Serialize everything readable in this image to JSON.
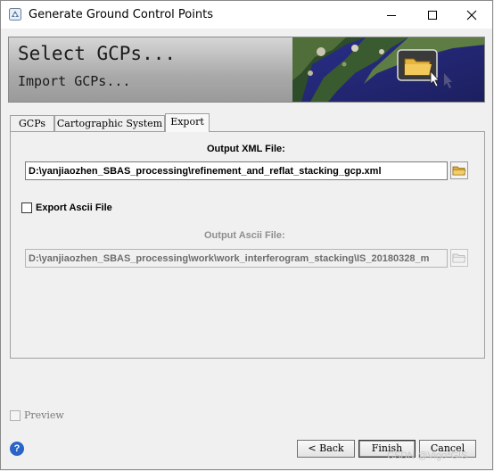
{
  "window": {
    "title": "Generate Ground Control Points",
    "controls": [
      "minimize-icon",
      "maximize-icon",
      "close-icon"
    ]
  },
  "banner": {
    "title": "Select GCPs...",
    "subtitle": "Import GCPs..."
  },
  "tabs": [
    {
      "label": "GCPs",
      "active": false
    },
    {
      "label": "Cartographic System",
      "active": false
    },
    {
      "label": "Export",
      "active": true
    }
  ],
  "export": {
    "output_xml_label": "Output XML File:",
    "output_xml_value": "D:\\yanjiaozhen_SBAS_processing\\refinement_and_reflat_stacking_gcp.xml",
    "export_ascii_label": "Export Ascii File",
    "export_ascii_checked": false,
    "output_ascii_label": "Output Ascii File:",
    "output_ascii_value": "D:\\yanjiaozhen_SBAS_processing\\work\\work_interferogram_stacking\\IS_20180328_m"
  },
  "footer": {
    "preview_label": "Preview",
    "preview_checked": false,
    "help_label": "?",
    "back_label": "< Back",
    "finish_label": "Finish",
    "cancel_label": "Cancel",
    "watermark": "CSDN @Vigo*GIS"
  }
}
